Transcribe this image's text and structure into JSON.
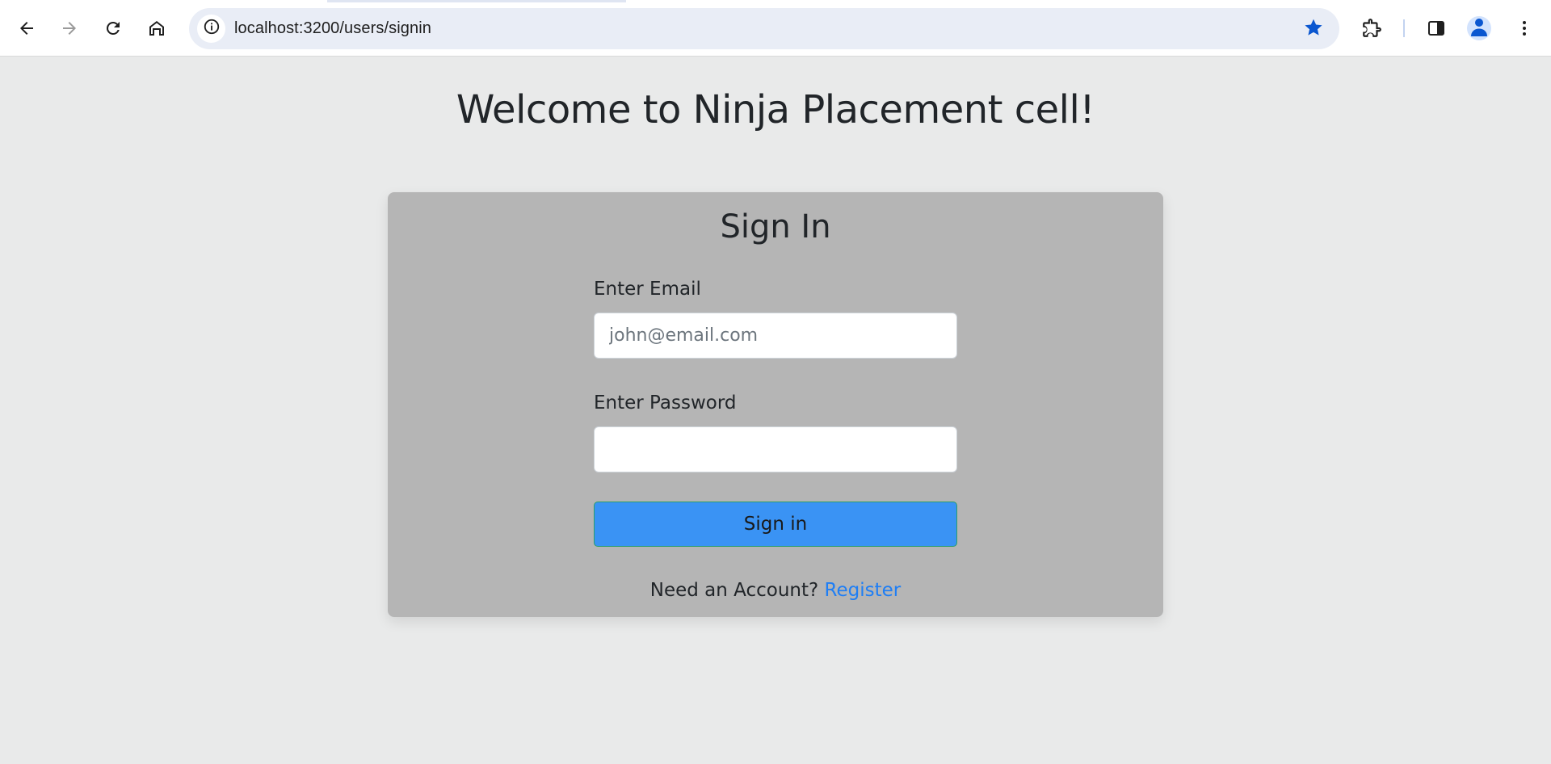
{
  "browser": {
    "url": "localhost:3200/users/signin",
    "icons": {
      "back": "arrow-left-icon",
      "forward": "arrow-right-icon",
      "reload": "reload-icon",
      "home": "home-icon",
      "site_info": "info-circle-icon",
      "bookmark": "star-filled-icon",
      "extensions": "puzzle-icon",
      "side_panel": "side-panel-icon",
      "profile": "person-icon",
      "menu": "kebab-menu-icon"
    },
    "colors": {
      "accent": "#0b57d0",
      "omnibox_bg": "#e9edf6"
    }
  },
  "page": {
    "heading": "Welcome to Ninja Placement cell!",
    "background": "#e9eaea"
  },
  "signin": {
    "title": "Sign In",
    "email_label": "Enter Email",
    "email_placeholder": "john@email.com",
    "email_value": "",
    "password_label": "Enter Password",
    "password_value": "",
    "submit_label": "Sign in",
    "register_prompt": "Need an Account?",
    "register_link": "Register",
    "colors": {
      "card_bg": "#b5b5b5",
      "button_bg": "#3a93f4",
      "link": "#1e7ef5"
    }
  }
}
